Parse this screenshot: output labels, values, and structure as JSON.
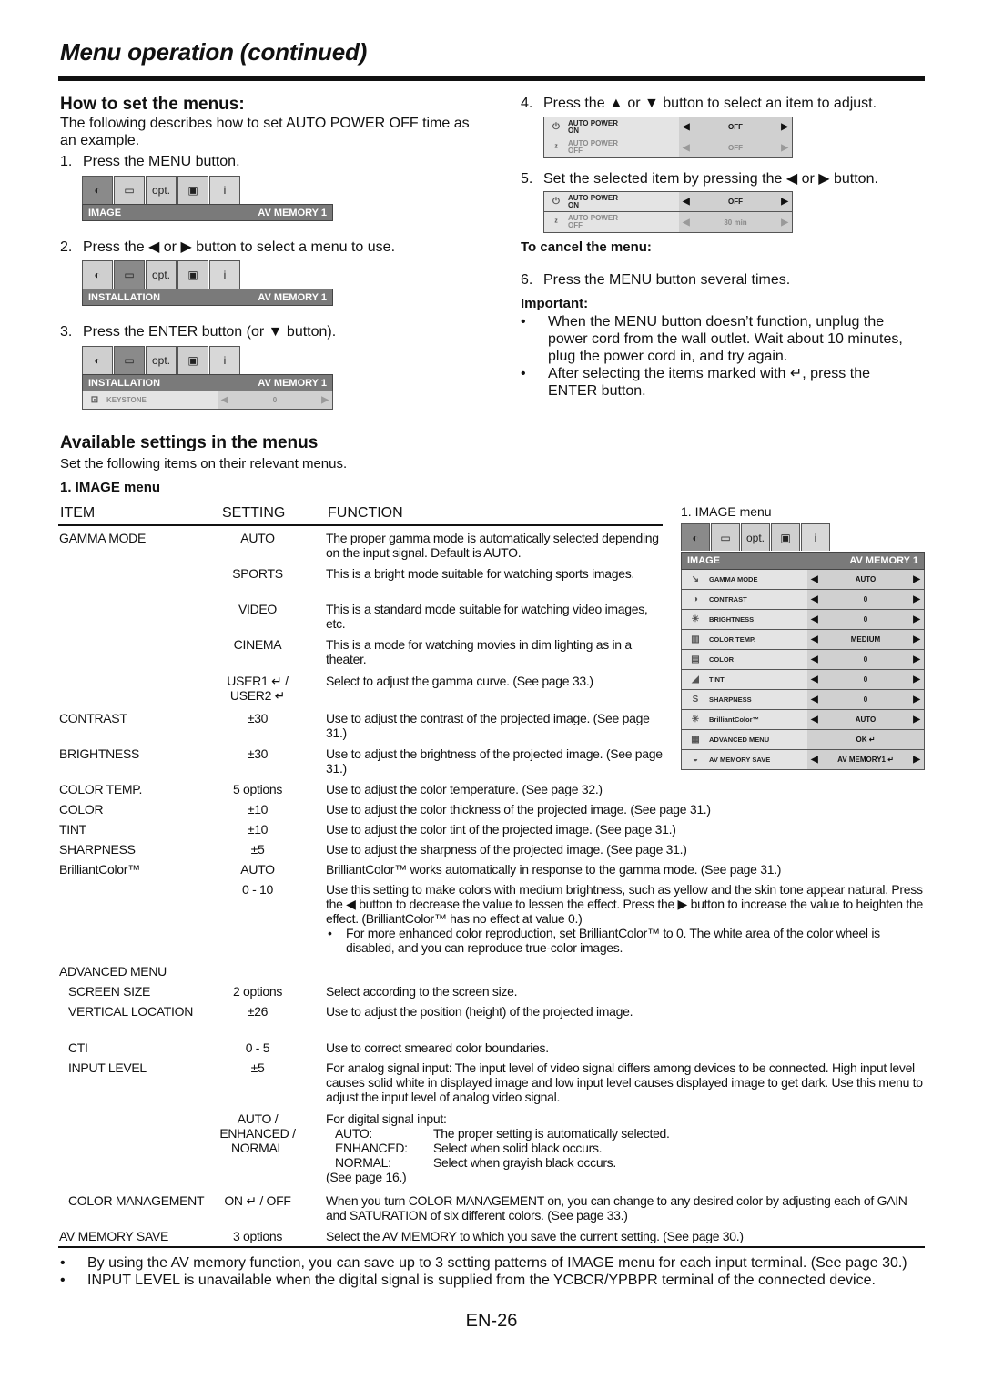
{
  "page": {
    "title": "Menu operation (continued)",
    "page_number": "EN-26"
  },
  "how_to": {
    "heading": "How to set the menus:",
    "intro": "The following describes how to set AUTO POWER OFF time as an example.",
    "steps": [
      {
        "num": "1.",
        "text": "Press the MENU button."
      },
      {
        "num": "2.",
        "text": "Press the ◀ or ▶ button to select a menu to use."
      },
      {
        "num": "3.",
        "text": "Press the ENTER button (or ▼ button)."
      },
      {
        "num": "4.",
        "text": "Press the ▲ or ▼ button to select an item to adjust."
      },
      {
        "num": "5.",
        "text": "Set the selected item by pressing the ◀ or ▶ button."
      }
    ],
    "cancel_heading": "To cancel the menu:",
    "cancel_step": {
      "num": "6.",
      "text": "Press the MENU button several times."
    },
    "important_heading": "Important:",
    "important": [
      "When the MENU button doesn’t function, unplug the power cord from the wall outlet. Wait about 10 minutes, plug the power cord in, and try again.",
      "After selecting the items marked with ↵, press the ENTER button."
    ]
  },
  "osd": {
    "tabs": [
      {
        "icon": "image-adjust-icon",
        "glyph": "◐"
      },
      {
        "icon": "installation-icon",
        "glyph": "▭"
      },
      {
        "icon": "option-icon",
        "glyph": "opt."
      },
      {
        "icon": "signal-icon",
        "glyph": "▣"
      },
      {
        "icon": "info-icon",
        "glyph": "i"
      }
    ],
    "menu1": {
      "title": "IMAGE",
      "memory": "AV MEMORY 1"
    },
    "menu2": {
      "title": "INSTALLATION",
      "memory": "AV MEMORY 1"
    },
    "menu3": {
      "title": "INSTALLATION",
      "memory": "AV MEMORY 1",
      "row": {
        "label": "KEYSTONE",
        "value": "0"
      }
    },
    "step4_rows": [
      {
        "label1": "AUTO POWER",
        "label2": "ON",
        "value": "OFF"
      },
      {
        "label1": "AUTO POWER",
        "label2": "OFF",
        "value": "OFF"
      }
    ],
    "step5_rows": [
      {
        "label1": "AUTO POWER",
        "label2": "ON",
        "value": "OFF"
      },
      {
        "label1": "AUTO POWER",
        "label2": "OFF",
        "value": "30 min"
      }
    ],
    "arrows": {
      "left": "◀",
      "right": "▶"
    }
  },
  "available": {
    "heading": "Available settings in the menus",
    "intro": "Set the following items on their relevant menus.",
    "subheading": "1. IMAGE menu",
    "columns": [
      "ITEM",
      "SETTING",
      "FUNCTION"
    ],
    "figure_caption": "1. IMAGE menu",
    "image_menu": {
      "title": "IMAGE",
      "memory": "AV MEMORY 1",
      "rows": [
        {
          "label": "GAMMA MODE",
          "value": "AUTO",
          "icon": "gamma-icon",
          "glyph": "↘"
        },
        {
          "label": "CONTRAST",
          "value": "0",
          "icon": "contrast-icon",
          "glyph": "◑"
        },
        {
          "label": "BRIGHTNESS",
          "value": "0",
          "icon": "brightness-icon",
          "glyph": "☀"
        },
        {
          "label": "COLOR TEMP.",
          "value": "MEDIUM",
          "icon": "color-temp-icon",
          "glyph": "▥"
        },
        {
          "label": "COLOR",
          "value": "0",
          "icon": "color-icon",
          "glyph": "▤"
        },
        {
          "label": "TINT",
          "value": "0",
          "icon": "tint-icon",
          "glyph": "◢"
        },
        {
          "label": "SHARPNESS",
          "value": "0",
          "icon": "sharpness-icon",
          "glyph": "S"
        },
        {
          "label": "BrilliantColor™",
          "value": "AUTO",
          "icon": "brilliantcolor-icon",
          "glyph": "✳"
        },
        {
          "label": "ADVANCED MENU",
          "value": "OK ↵",
          "icon": "advanced-menu-icon",
          "glyph": "▦"
        },
        {
          "label": "AV MEMORY SAVE",
          "value": "AV MEMORY1 ↵",
          "icon": "av-memory-icon",
          "glyph": "◒"
        }
      ]
    },
    "table": [
      {
        "item": "GAMMA MODE",
        "setting": "AUTO",
        "function": "The proper gamma mode is automatically selected depending on the input signal. Default is AUTO."
      },
      {
        "item": "",
        "setting": "SPORTS",
        "function": "This is a bright mode suitable for watching sports images."
      },
      {
        "item": "",
        "setting": "VIDEO",
        "function": "This is a standard mode suitable for watching video images, etc."
      },
      {
        "item": "",
        "setting": "CINEMA",
        "function": "This is a mode for watching movies in dim lighting as in a theater."
      },
      {
        "item": "",
        "setting": "USER1 ↵ / USER2 ↵",
        "function": "Select to adjust the gamma curve. (See page 33.)"
      },
      {
        "item": "CONTRAST",
        "setting": "±30",
        "function": "Use to adjust the contrast of the projected image. (See page 31.)"
      },
      {
        "item": "BRIGHTNESS",
        "setting": "±30",
        "function": "Use to adjust the brightness of the projected image. (See page 31.)"
      },
      {
        "item": "COLOR TEMP.",
        "setting": "5 options",
        "function": "Use to adjust the color temperature. (See page 32.)"
      },
      {
        "item": "COLOR",
        "setting": "±10",
        "function": "Use to adjust the color thickness of the projected image. (See page 31.)"
      },
      {
        "item": "TINT",
        "setting": "±10",
        "function": "Use to adjust the color tint of the projected image. (See page 31.)"
      },
      {
        "item": "SHARPNESS",
        "setting": "±5",
        "function": "Use to adjust the sharpness of the projected image. (See page 31.)"
      },
      {
        "item": "BrilliantColor™",
        "setting": "AUTO",
        "function": "BrilliantColor™ works automatically in response to the gamma mode. (See page 31.)"
      },
      {
        "item": "",
        "setting": "0 - 10",
        "function": "Use this setting to make colors with medium brightness, such as yellow and the skin tone appear natural. Press the ◀ button to decrease the value to lessen the effect. Press the ▶ button to increase the value to heighten the effect. (BrilliantColor™ has no effect at value 0.)",
        "note": "For more enhanced color reproduction, set BrilliantColor™ to 0. The white area of the color wheel is disabled, and you can reproduce true-color images."
      },
      {
        "item": "ADVANCED MENU",
        "setting": "",
        "function": ""
      },
      {
        "item": "SCREEN SIZE",
        "setting": "2 options",
        "function": "Select according to the screen size."
      },
      {
        "item": "VERTICAL LOCATION",
        "setting": "±26",
        "function": "Use to adjust the position (height) of the projected image."
      },
      {
        "item": "CTI",
        "setting": "0 - 5",
        "function": "Use to correct smeared color boundaries."
      },
      {
        "item": "INPUT LEVEL",
        "setting": "±5",
        "function": "For analog signal input: The input level of video signal differs among devices to be connected. High input level causes solid white in displayed image and low input level causes displayed image to get dark. Use this menu to adjust the input level of analog video signal."
      },
      {
        "item": "",
        "setting": "AUTO / ENHANCED / NORMAL",
        "function": "For digital signal input:",
        "options": [
          {
            "k": "AUTO:",
            "v": "The proper setting is automatically selected."
          },
          {
            "k": "ENHANCED:",
            "v": "Select when solid black occurs."
          },
          {
            "k": "NORMAL:",
            "v": "Select when grayish black occurs."
          }
        ],
        "tail": "(See page 16.)"
      },
      {
        "item": "COLOR MANAGEMENT",
        "setting": "ON ↵ / OFF",
        "function": "When you turn COLOR MANAGEMENT on, you can change to any desired color by adjusting each of GAIN and SATURATION of six different colors. (See page 33.)"
      },
      {
        "item": "AV MEMORY SAVE",
        "setting": "3 options",
        "function": "Select the AV MEMORY to which you save the current setting. (See page 30.)"
      }
    ],
    "footnotes": [
      "By using the AV memory function, you can save up to 3 setting patterns of IMAGE menu for each input terminal. (See page 30.)",
      "INPUT LEVEL is unavailable when the digital signal is supplied from the YCBCR/YPBPR terminal of the connected device."
    ]
  }
}
